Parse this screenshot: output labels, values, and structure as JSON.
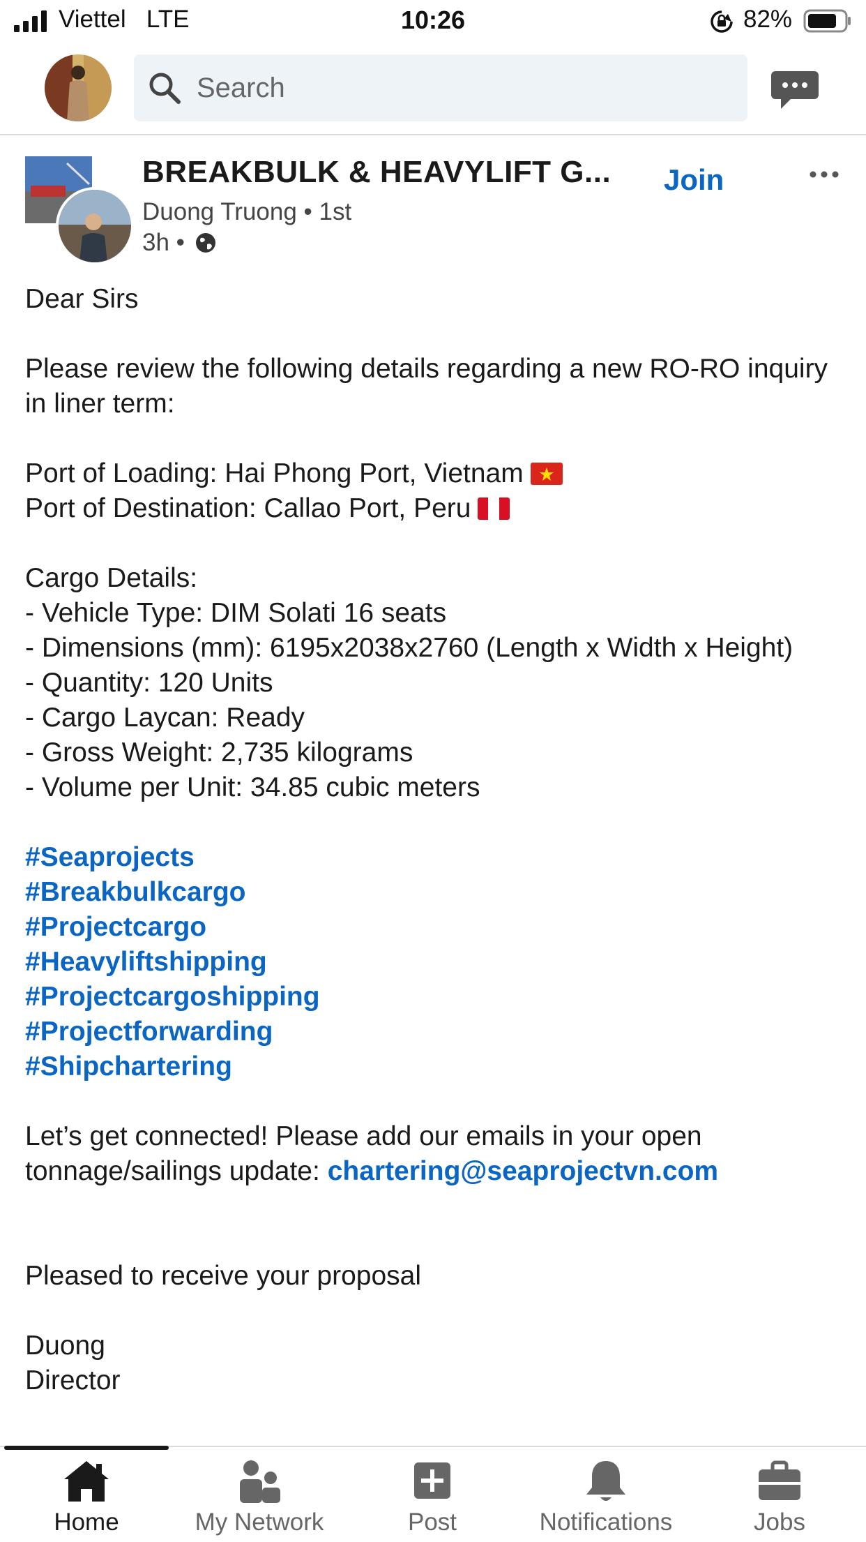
{
  "status_bar": {
    "carrier": "Viettel",
    "network": "LTE",
    "time": "10:26",
    "battery": "82%"
  },
  "search": {
    "placeholder": "Search"
  },
  "post": {
    "group_name": "BREAKBULK & HEAVYLIFT G...",
    "author": "Duong Truong",
    "connection": "1st",
    "time_ago": "3h",
    "join_label": "Join",
    "greeting": "Dear Sirs",
    "intro": "Please review the following details regarding a new RO-RO inquiry in liner term:",
    "port_loading": "Port of Loading: Hai Phong Port, Vietnam",
    "port_destination": "Port of Destination: Callao Port, Peru",
    "cargo_heading": "Cargo Details:",
    "cargo_lines": [
      "- Vehicle Type: DIM Solati 16 seats",
      "- Dimensions (mm): 6195x2038x2760 (Length x Width x Height)",
      "- Quantity: 120 Units",
      "- Cargo Laycan: Ready",
      "- Gross Weight: 2,735 kilograms",
      "- Volume per Unit: 34.85 cubic meters"
    ],
    "hashtags": [
      "#Seaprojects",
      "#Breakbulkcargo",
      "#Projectcargo",
      "#Heavyliftshipping",
      "#Projectcargoshipping",
      "#Projectforwarding",
      "#Shipchartering"
    ],
    "connect_text": "Let’s get connected! Please add our emails in your open tonnage/sailings update:",
    "email": "chartering@seaprojectvn.com",
    "closing": "Pleased to receive your proposal",
    "signature_name": "Duong",
    "signature_title": "Director"
  },
  "nav": {
    "items": [
      {
        "label": "Home",
        "icon": "home-icon",
        "active": true
      },
      {
        "label": "My Network",
        "icon": "network-icon",
        "active": false
      },
      {
        "label": "Post",
        "icon": "post-icon",
        "active": false
      },
      {
        "label": "Notifications",
        "icon": "bell-icon",
        "active": false
      },
      {
        "label": "Jobs",
        "icon": "briefcase-icon",
        "active": false
      }
    ]
  },
  "colors": {
    "accent": "#0a66c2",
    "search_bg": "#eef3f8",
    "nav_inactive": "#666666"
  }
}
